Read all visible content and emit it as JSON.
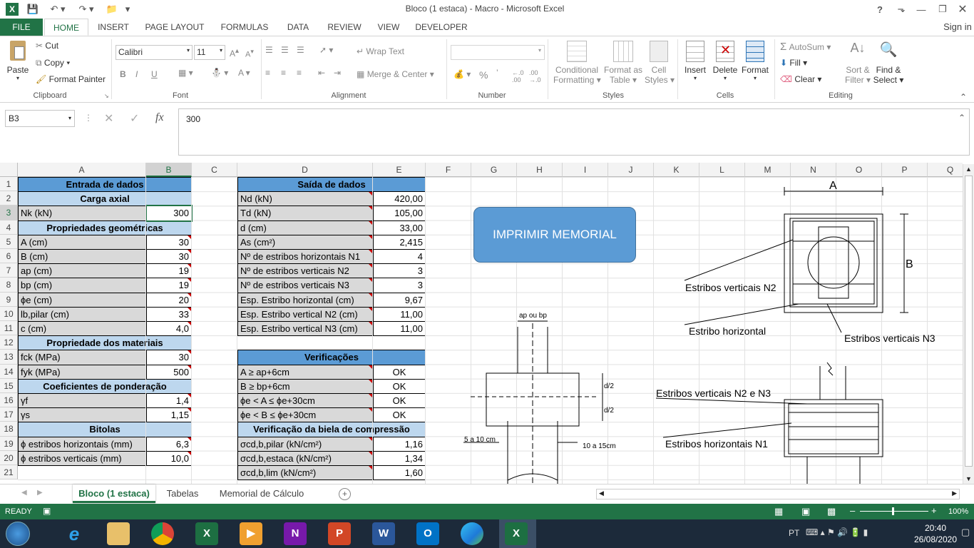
{
  "window": {
    "title": "Bloco (1 estaca) - Macro - Microsoft Excel",
    "signin": "Sign in"
  },
  "tabs": [
    "FILE",
    "HOME",
    "INSERT",
    "PAGE LAYOUT",
    "FORMULAS",
    "DATA",
    "REVIEW",
    "VIEW",
    "DEVELOPER"
  ],
  "ribbon": {
    "clipboard": {
      "paste": "Paste",
      "cut": "Cut",
      "copy": "Copy",
      "format_painter": "Format Painter",
      "label": "Clipboard"
    },
    "font": {
      "name": "Calibri",
      "size": "11",
      "label": "Font",
      "bold": "B",
      "italic": "I",
      "underline": "U"
    },
    "alignment": {
      "wrap": "Wrap Text",
      "merge": "Merge & Center",
      "label": "Alignment"
    },
    "number": {
      "label": "Number",
      "percent": "%"
    },
    "styles": {
      "conditional": "Conditional",
      "conditional2": "Formatting",
      "format_table": "Format as",
      "format_table2": "Table",
      "cell_styles": "Cell",
      "cell_styles2": "Styles",
      "label": "Styles"
    },
    "cells": {
      "insert": "Insert",
      "delete": "Delete",
      "format": "Format",
      "label": "Cells"
    },
    "editing": {
      "autosum": "AutoSum",
      "fill": "Fill",
      "clear": "Clear",
      "sort": "Sort &",
      "sort2": "Filter",
      "find": "Find &",
      "find2": "Select",
      "label": "Editing"
    }
  },
  "formula_bar": {
    "name_box": "B3",
    "content": "300",
    "fx": "fx"
  },
  "columns": [
    "A",
    "B",
    "C",
    "D",
    "E",
    "F",
    "G",
    "H",
    "I",
    "J",
    "K",
    "L",
    "M",
    "N",
    "O",
    "P",
    "Q"
  ],
  "rows": [
    "1",
    "2",
    "3",
    "4",
    "5",
    "6",
    "7",
    "8",
    "9",
    "10",
    "11",
    "12",
    "13",
    "14",
    "15",
    "16",
    "17",
    "18",
    "19",
    "20",
    "21"
  ],
  "entrada": {
    "title": "Entrada de dados",
    "carga": "Carga axial",
    "nk_label": "Nk (kN)",
    "nk": "300",
    "geom": "Propriedades geométricas",
    "geom_rows": [
      [
        "A (cm)",
        "30"
      ],
      [
        "B (cm)",
        "30"
      ],
      [
        "ap (cm)",
        "19"
      ],
      [
        "bp (cm)",
        "19"
      ],
      [
        "ϕe (cm)",
        "20"
      ],
      [
        "lb,pilar (cm)",
        "33"
      ],
      [
        "c (cm)",
        "4,0"
      ]
    ],
    "mat": "Propriedade dos materiais",
    "mat_rows": [
      [
        "fck (MPa)",
        "30"
      ],
      [
        "fyk (MPa)",
        "500"
      ]
    ],
    "coef": "Coeficientes de ponderação",
    "coef_rows": [
      [
        "γf",
        "1,4"
      ],
      [
        "γs",
        "1,15"
      ]
    ],
    "bitolas": "Bitolas",
    "bit_rows": [
      [
        "ϕ estribos horizontais (mm)",
        "6,3"
      ],
      [
        "ϕ estribos verticais (mm)",
        "10,0"
      ]
    ]
  },
  "saida": {
    "title": "Saída de dados",
    "rows": [
      [
        "Nd (kN)",
        "420,00"
      ],
      [
        "Td (kN)",
        "105,00"
      ],
      [
        "d (cm)",
        "33,00"
      ],
      [
        "As (cm²)",
        "2,415"
      ],
      [
        "Nº de estribos horizontais N1",
        "4"
      ],
      [
        "Nº de estribos verticais N2",
        "3"
      ],
      [
        "Nº de estribos verticais N3",
        "3"
      ],
      [
        "Esp. Estribo horizontal (cm)",
        "9,67"
      ],
      [
        "Esp. Estribo vertical N2 (cm)",
        "11,00"
      ],
      [
        "Esp. Estribo vertical N3 (cm)",
        "11,00"
      ]
    ],
    "verif": "Verificações",
    "verif_rows": [
      [
        "A ≥ ap+6cm",
        "OK"
      ],
      [
        "B ≥ bp+6cm",
        "OK"
      ],
      [
        "ϕe < A ≤ ϕe+30cm",
        "OK"
      ],
      [
        "ϕe < B ≤ ϕe+30cm",
        "OK"
      ]
    ],
    "biela": "Verificação da biela de compressão",
    "biela_rows": [
      [
        "σcd,b,pilar (kN/cm²)",
        "1,16"
      ],
      [
        "σcd,b,estaca (kN/cm²)",
        "1,34"
      ],
      [
        "σcd,b,lim (kN/cm²)",
        "1,60"
      ]
    ]
  },
  "button": "IMPRIMIR MEMORIAL",
  "drawing": {
    "a": "A",
    "b": "B",
    "est_vert_n2": "Estribos verticais N2",
    "est_horiz": "Estribo horizontal",
    "est_vert_n3": "Estribos verticais N3",
    "ap_bp": "ap ou bp",
    "d2a": "d/2",
    "d2b": "d/2",
    "cm5_10": "5 a 10 cm",
    "cm10_15": "10 a 15cm",
    "est_vert_n2n3": "Estribos verticais N2 e N3",
    "est_horiz_n1": "Estribos horizontais N1"
  },
  "sheets": [
    "Bloco (1 estaca)",
    "Tabelas",
    "Memorial de Cálculo"
  ],
  "status": {
    "ready": "READY",
    "zoom": "100%"
  },
  "taskbar": {
    "lang": "PT",
    "time": "20:40",
    "date": "26/08/2020"
  },
  "colors": {
    "excel_green": "#217346",
    "header_blue": "#5b9bd5",
    "subheader_blue": "#bdd7ee",
    "label_gray": "#d9d9d9"
  }
}
